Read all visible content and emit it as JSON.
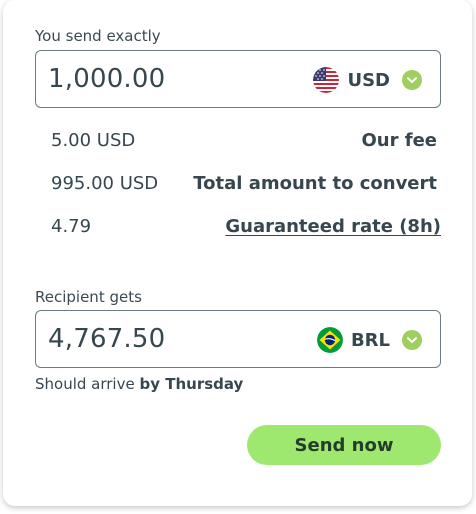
{
  "send": {
    "label": "You send exactly",
    "amount": "1,000.00",
    "currency": "USD",
    "flag_icon": "us-flag-icon"
  },
  "details": {
    "fee_value": "5.00 USD",
    "fee_label": "Our fee",
    "convert_value": "995.00 USD",
    "convert_label": "Total amount to convert",
    "rate_value": "4.79",
    "rate_label": "Guaranteed rate (8h)"
  },
  "receive": {
    "label": "Recipient gets",
    "amount": "4,767.50",
    "currency": "BRL",
    "flag_icon": "brazil-flag-icon"
  },
  "arrival": {
    "prefix": "Should arrive",
    "when": "by Thursday"
  },
  "actions": {
    "send_now": "Send now"
  },
  "colors": {
    "accent_green": "#9fe870",
    "chevron_green": "#9fcf5e",
    "text": "#37474f"
  }
}
